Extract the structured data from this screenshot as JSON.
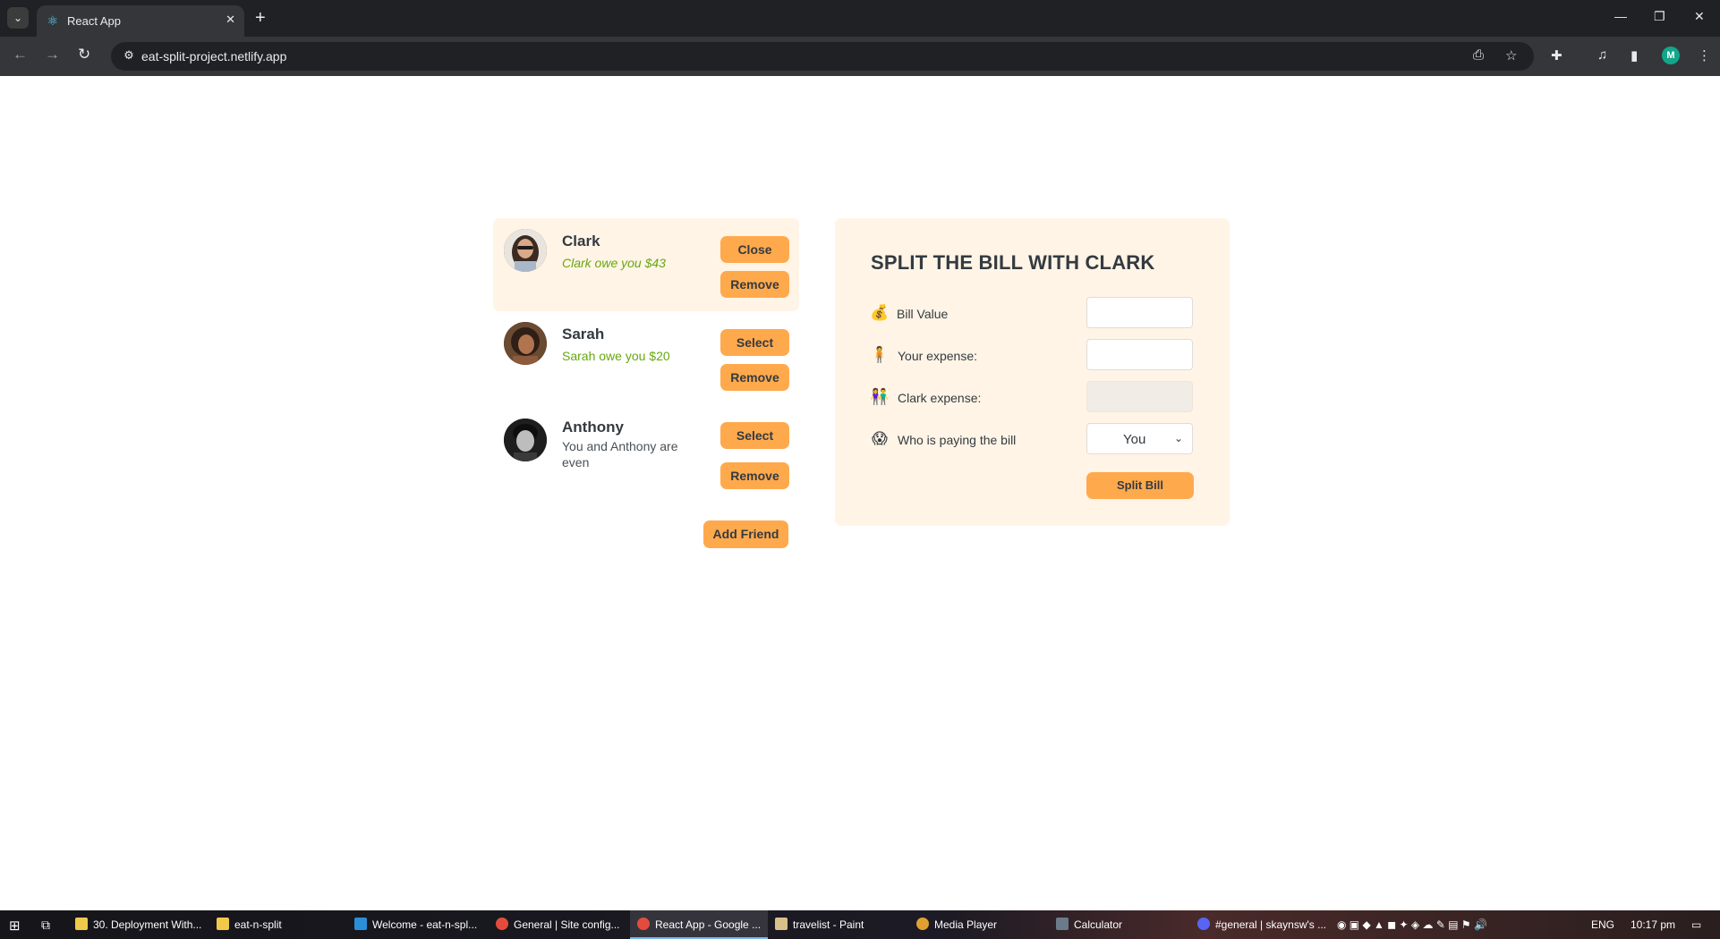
{
  "browser": {
    "tab_title": "React App",
    "url": "eat-split-project.netlify.app",
    "profile_initial": "M"
  },
  "friends": [
    {
      "name": "Clark",
      "status": "Clark owe you $43",
      "primary_button": "Close",
      "remove_button": "Remove",
      "selected": true
    },
    {
      "name": "Sarah",
      "status": "Sarah owe you $20",
      "primary_button": "Select",
      "remove_button": "Remove",
      "selected": false
    },
    {
      "name": "Anthony",
      "status": "You and Anthony are even",
      "primary_button": "Select",
      "remove_button": "Remove",
      "selected": false
    }
  ],
  "add_friend_label": "Add Friend",
  "split_form": {
    "title": "SPLIT THE BILL WITH CLARK",
    "bill_value_label": "Bill Value",
    "bill_value": "",
    "your_expense_label": "Your expense:",
    "your_expense": "",
    "friend_expense_label": "Clark expense:",
    "friend_expense": "",
    "payer_label": "Who is paying the bill",
    "payer_selected": "You",
    "submit_label": "Split Bill",
    "icons": [
      "money-bag-icon",
      "face-icon",
      "person-icon",
      "surprised-face-icon"
    ]
  },
  "taskbar": {
    "items": [
      "30. Deployment With...",
      "eat-n-split",
      "Welcome - eat-n-spl...",
      "General | Site config...",
      "React App - Google ...",
      "travelist - Paint",
      "Media Player",
      "Calculator",
      "#general | skaynsw's ..."
    ],
    "language": "ENG",
    "time": "10:17 pm"
  },
  "colors": {
    "accent": "#ffa94d",
    "panel": "#fff4e6",
    "positive": "#66a80f",
    "text": "#343a40"
  }
}
